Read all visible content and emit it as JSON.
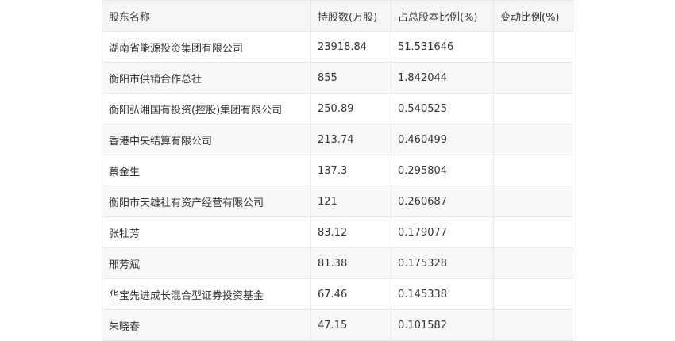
{
  "table": {
    "headers": {
      "name": "股东名称",
      "shares": "持股数(万股)",
      "ratio": "占总股本比例(%)",
      "change": "变动比例(%)"
    },
    "rows": [
      {
        "name": "湖南省能源投资集团有限公司",
        "shares": "23918.84",
        "ratio": "51.531646",
        "change": ""
      },
      {
        "name": "衡阳市供销合作总社",
        "shares": "855",
        "ratio": "1.842044",
        "change": ""
      },
      {
        "name": "衡阳弘湘国有投资(控股)集团有限公司",
        "shares": "250.89",
        "ratio": "0.540525",
        "change": ""
      },
      {
        "name": "香港中央结算有限公司",
        "shares": "213.74",
        "ratio": "0.460499",
        "change": ""
      },
      {
        "name": "蔡金生",
        "shares": "137.3",
        "ratio": "0.295804",
        "change": ""
      },
      {
        "name": "衡阳市天雄社有资产经营有限公司",
        "shares": "121",
        "ratio": "0.260687",
        "change": ""
      },
      {
        "name": "张牡芳",
        "shares": "83.12",
        "ratio": "0.179077",
        "change": ""
      },
      {
        "name": "邢芳斌",
        "shares": "81.38",
        "ratio": "0.175328",
        "change": ""
      },
      {
        "name": "华宝先进成长混合型证券投资基金",
        "shares": "67.46",
        "ratio": "0.145338",
        "change": ""
      },
      {
        "name": "朱晓春",
        "shares": "47.15",
        "ratio": "0.101582",
        "change": ""
      }
    ]
  }
}
